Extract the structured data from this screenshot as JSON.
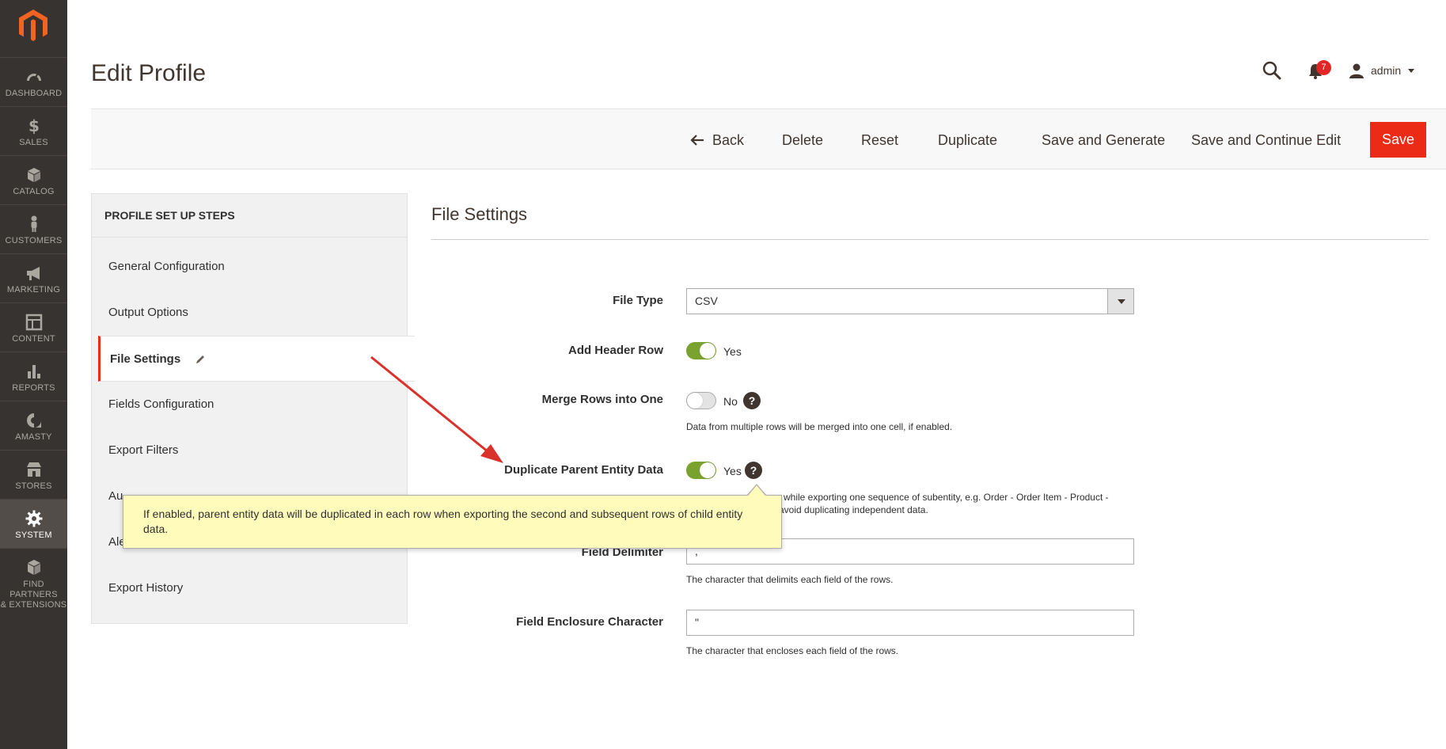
{
  "nav": {
    "items": [
      {
        "label": "DASHBOARD",
        "icon": "dashboard-icon"
      },
      {
        "label": "SALES",
        "icon": "dollar-icon"
      },
      {
        "label": "CATALOG",
        "icon": "box-icon"
      },
      {
        "label": "CUSTOMERS",
        "icon": "person-icon"
      },
      {
        "label": "MARKETING",
        "icon": "megaphone-icon"
      },
      {
        "label": "CONTENT",
        "icon": "layout-icon"
      },
      {
        "label": "REPORTS",
        "icon": "bar-chart-icon"
      },
      {
        "label": "AMASTY",
        "icon": "amasty-icon"
      },
      {
        "label": "STORES",
        "icon": "store-icon"
      },
      {
        "label": "SYSTEM",
        "icon": "gear-icon"
      },
      {
        "label_line1": "FIND PARTNERS",
        "label_line2": "& EXTENSIONS",
        "icon": "boxes-icon"
      }
    ]
  },
  "header": {
    "title": "Edit Profile",
    "notifications_count": "7",
    "user": "admin"
  },
  "actions": {
    "back": "Back",
    "delete": "Delete",
    "reset": "Reset",
    "duplicate": "Duplicate",
    "save_generate": "Save and Generate",
    "save_continue": "Save and Continue Edit",
    "save": "Save"
  },
  "steps": {
    "heading": "PROFILE SET UP STEPS",
    "items": [
      "General Configuration",
      "Output Options",
      "File Settings",
      "Fields Configuration",
      "Export Filters",
      "Au",
      "Ale",
      "Export History"
    ]
  },
  "section": {
    "title": "File Settings",
    "file_type": {
      "label": "File Type",
      "value": "CSV"
    },
    "header_row": {
      "label": "Add Header Row",
      "value": "Yes",
      "enabled": true
    },
    "merge_rows": {
      "label": "Merge Rows into One",
      "value": "No",
      "enabled": false,
      "note": "Data from multiple rows will be merged into one cell, if enabled."
    },
    "dup_parent": {
      "label": "Duplicate Parent Entity Data",
      "value": "Yes",
      "enabled": true,
      "note_line1": "while exporting one sequence of subentity, e.g. Order - Order Item - Product -",
      "note_line2": "avoid duplicating independent data."
    },
    "field_delimiter": {
      "label": "Field Delimiter",
      "value": ",",
      "note": "The character that delimits each field of the rows."
    },
    "field_enclosure": {
      "label": "Field Enclosure Character",
      "value": "\"",
      "note": "The character that encloses each field of the rows."
    }
  },
  "tooltip": {
    "text": "If enabled, parent entity data will be duplicated in each row when exporting the second and subsequent rows of child entity data."
  },
  "help_glyph": "?",
  "colors": {
    "nav_bg": "#373330",
    "accent": "#eb2b15",
    "toggle_on": "#79a22e",
    "tooltip_bg": "#fffbbb",
    "annotation_arrow": "#d9322b"
  }
}
